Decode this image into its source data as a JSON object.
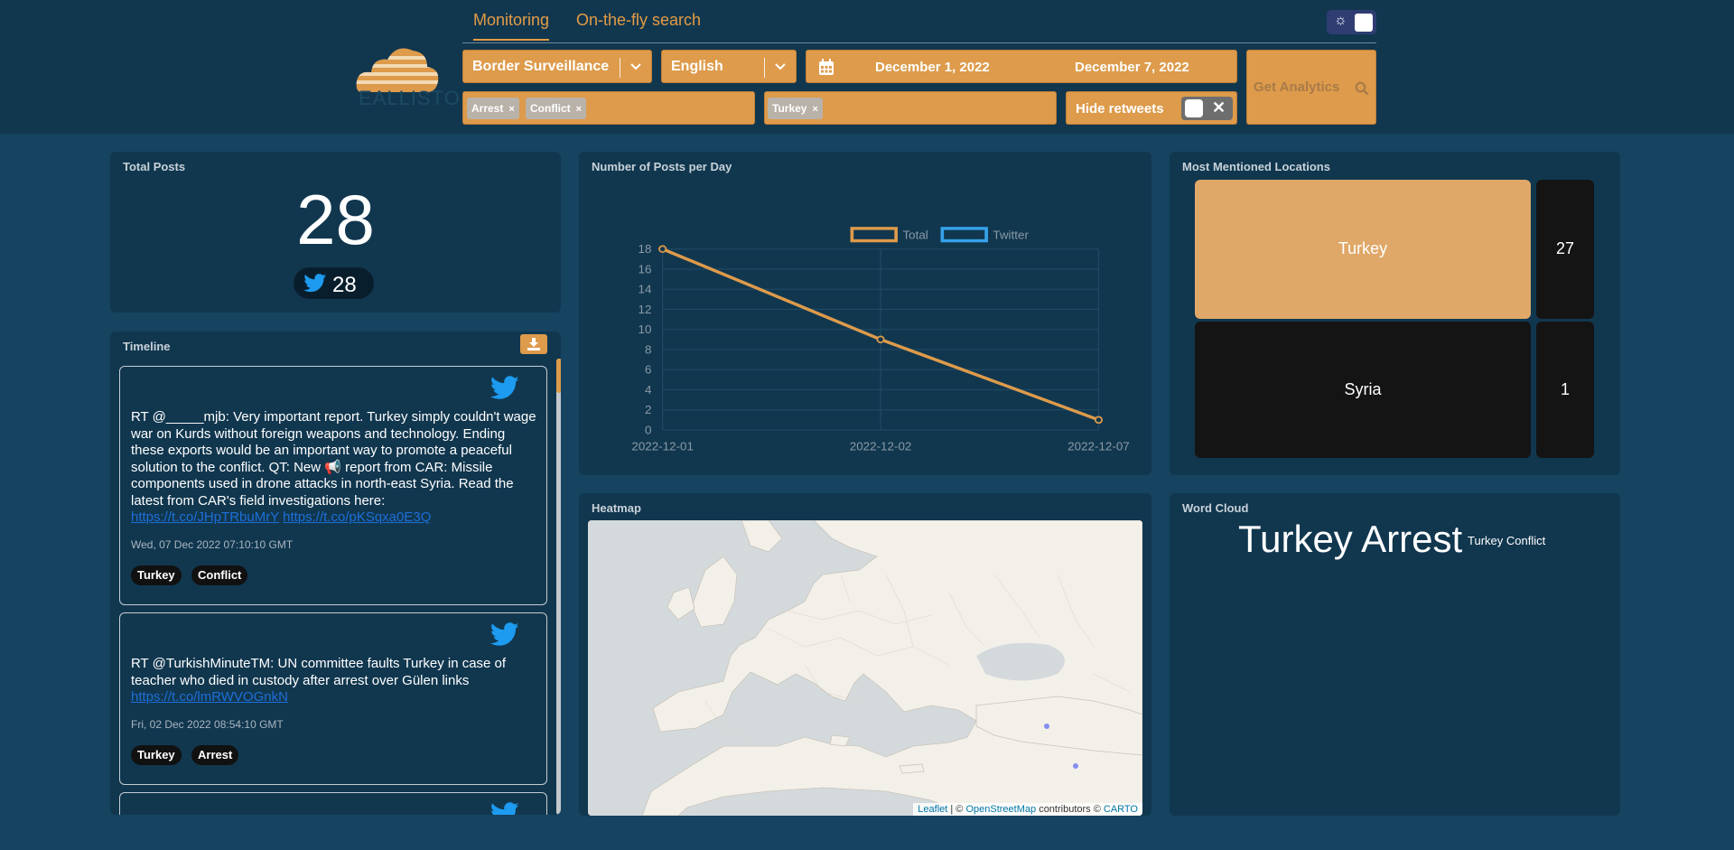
{
  "header": {
    "tabs": [
      "Monitoring",
      "On-the-fly search"
    ],
    "logo_text": "EALLISTO",
    "project_select": "Border Surveillance",
    "language_select": "English",
    "date_start": "December 1, 2022",
    "date_end": "December 7, 2022",
    "keywords": [
      "Arrest",
      "Conflict"
    ],
    "locations": [
      "Turkey"
    ],
    "hide_retweets_label": "Hide retweets",
    "analytics_button": "Get Analytics",
    "chip_remove": "×",
    "colors": {
      "accent": "#dd9b4b",
      "header_bg": "#11374f",
      "page_bg": "#154360"
    }
  },
  "total_posts": {
    "title": "Total Posts",
    "value": "28",
    "twitter_value": "28"
  },
  "timeline": {
    "title": "Timeline",
    "tweets": [
      {
        "text": "RT @_____mjb: Very important report. Turkey simply couldn't wage war on Kurds without foreign weapons and technology. Ending these exports would be an important way to promote a peaceful solution to the conflict. QT: New 📢 report from CAR: Missile components used in drone attacks in north-east Syria. Read the latest from CAR's field investigations here:",
        "links": [
          "https://t.co/JHpTRbuMrY",
          "https://t.co/pKSqxa0E3Q"
        ],
        "date": "Wed, 07 Dec 2022 07:10:10 GMT",
        "tags": [
          "Turkey",
          "Conflict"
        ]
      },
      {
        "text": "RT @TurkishMinuteTM: UN committee faults Turkey in case of teacher who died in custody after arrest over Gülen links",
        "links": [
          "https://t.co/lmRWVOGnkN"
        ],
        "date": "Fri, 02 Dec 2022 08:54:10 GMT",
        "tags": [
          "Turkey",
          "Arrest"
        ]
      }
    ]
  },
  "posts_chart": {
    "title": "Number of Posts per Day",
    "chart_data": {
      "type": "line",
      "x": [
        "2022-12-01",
        "2022-12-02",
        "2022-12-07"
      ],
      "series": [
        {
          "name": "Total",
          "values": [
            18,
            9,
            1
          ],
          "color": "#dd9b4b"
        },
        {
          "name": "Twitter",
          "values": [],
          "color": "#36a2eb"
        }
      ],
      "ylim": [
        0,
        18
      ],
      "yticks": [
        0,
        2,
        4,
        6,
        8,
        10,
        12,
        14,
        16,
        18
      ],
      "grid": true,
      "legend": "top"
    }
  },
  "locations": {
    "title": "Most Mentioned Locations",
    "items": [
      {
        "name": "Turkey",
        "count": "27",
        "color": "#e0a868"
      },
      {
        "name": "Syria",
        "count": "1",
        "color": "#141414"
      }
    ]
  },
  "heatmap": {
    "title": "Heatmap",
    "attribution_links": [
      "Leaflet",
      "OpenStreetMap",
      "CARTO"
    ],
    "attribution_sep": "| ©",
    "attribution_mid": "contributors ©"
  },
  "word_cloud": {
    "title": "Word Cloud",
    "words_large": "Turkey Arrest",
    "words_small": "Turkey Conflict"
  }
}
